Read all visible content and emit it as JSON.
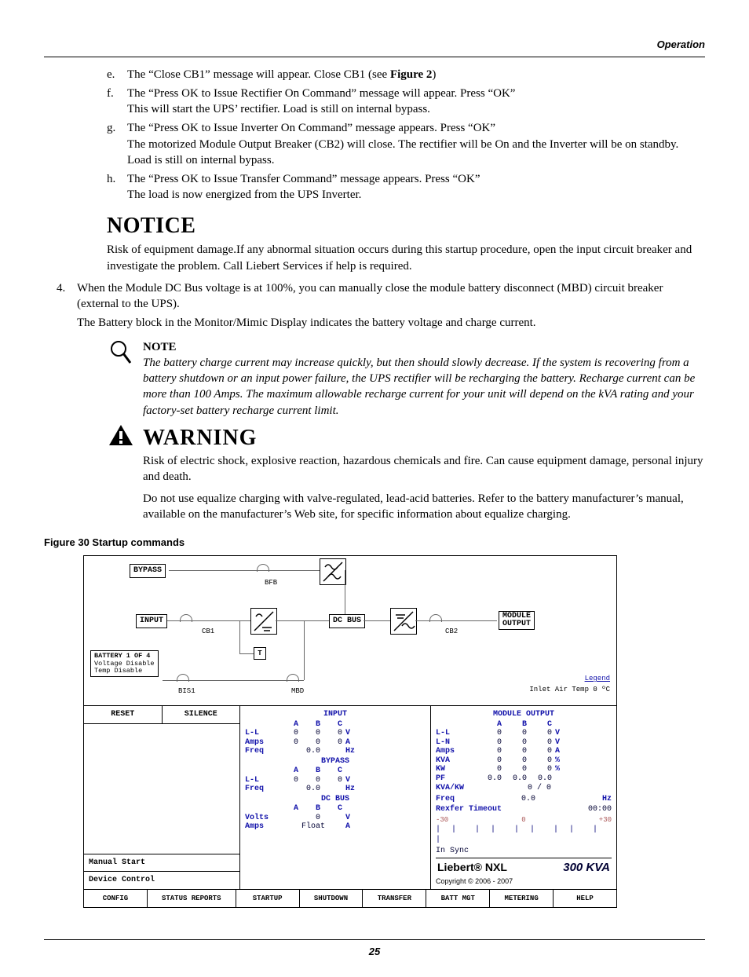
{
  "header": {
    "section": "Operation"
  },
  "steps": {
    "e": {
      "label": "e.",
      "text_a": "The “Close CB1” message will appear. Close CB1 (see ",
      "bold": "Figure 2",
      "text_b": ")"
    },
    "f": {
      "label": "f.",
      "line1": "The “Press OK to Issue Rectifier On Command” message will appear. Press “OK”",
      "line2": "This will start the UPS’ rectifier. Load is still on internal bypass."
    },
    "g": {
      "label": "g.",
      "line1": "The “Press OK to Issue Inverter On Command” message appears. Press “OK”",
      "line2": "The motorized Module Output Breaker (CB2) will close. The rectifier will be On and the Inverter will be on standby. Load is still on internal bypass."
    },
    "h": {
      "label": "h.",
      "line1": "The “Press OK to Issue Transfer Command” message appears. Press “OK”",
      "line2": "The load is now energized from the UPS Inverter."
    }
  },
  "notice": {
    "heading": "NOTICE",
    "body": "Risk of equipment damage.If any abnormal situation occurs during this startup procedure, open the input circuit breaker and investigate the problem. Call Liebert Services if help is required."
  },
  "step4": {
    "label": "4.",
    "line1": "When the Module DC Bus voltage is at 100%, you can manually close the module battery disconnect (MBD) circuit breaker (external to the UPS).",
    "line2": "The Battery block in the Monitor/Mimic Display indicates the battery voltage and charge current."
  },
  "note": {
    "heading": "NOTE",
    "body": "The battery charge current may increase quickly, but then should slowly decrease. If the system is recovering from a battery shutdown or an input power failure, the UPS rectifier will be recharging the battery. Recharge current can be more than 100 Amps. The maximum allowable recharge current for your unit will depend on the kVA rating and your factory-set battery recharge current limit."
  },
  "warning": {
    "heading": "WARNING",
    "p1": "Risk of electric shock, explosive reaction, hazardous chemicals and fire. Can cause equipment damage, personal injury and death.",
    "p2": "Do not use equalize charging with valve-regulated, lead-acid batteries. Refer to the battery manufacturer’s manual, available on the manufacturer’s Web site, for specific information about equalize charging."
  },
  "figure": {
    "caption": "Figure 30   Startup commands"
  },
  "mimic": {
    "top": {
      "bypass": "BYPASS",
      "bfb": "BFB",
      "input": "INPUT",
      "cb1": "CB1",
      "dcbus": "DC BUS",
      "cb2": "CB2",
      "module_output_l1": "MODULE",
      "module_output_l2": "OUTPUT",
      "battery_title": "BATTERY 1 OF 4",
      "batt_l1": "Voltage Disable",
      "batt_l2": "Temp   Disable",
      "bis1": "BIS1",
      "t": "T",
      "mbd": "MBD",
      "legend": "Legend",
      "inlet": "Inlet Air Temp 0 ºC"
    },
    "left": {
      "reset": "RESET",
      "silence": "SILENCE",
      "manual": "Manual Start",
      "device": "Device Control"
    },
    "center": {
      "input_hdr": "INPUT",
      "cols": {
        "a": "A",
        "b": "B",
        "c": "C"
      },
      "rows_input": [
        {
          "label": "L-L",
          "a": "0",
          "b": "0",
          "c": "0",
          "unit": "V"
        },
        {
          "label": "Amps",
          "a": "0",
          "b": "0",
          "c": "0",
          "unit": "A"
        },
        {
          "label": "Freq",
          "a": "",
          "b": "0.0",
          "c": "",
          "unit": "Hz"
        }
      ],
      "bypass_hdr": "BYPASS",
      "rows_bypass": [
        {
          "label": "L-L",
          "a": "0",
          "b": "0",
          "c": "0",
          "unit": "V"
        },
        {
          "label": "Freq",
          "a": "",
          "b": "0.0",
          "c": "",
          "unit": "Hz"
        }
      ],
      "dcbus_hdr": "DC BUS",
      "rows_dc": [
        {
          "label": "Volts",
          "a": "",
          "b": "0",
          "c": "",
          "unit": "V"
        },
        {
          "label": "Amps",
          "a": "",
          "b": "Float",
          "c": "",
          "unit": "A"
        }
      ]
    },
    "right": {
      "hdr": "MODULE OUTPUT",
      "cols": {
        "a": "A",
        "b": "B",
        "c": "C"
      },
      "rows": [
        {
          "label": "L-L",
          "a": "0",
          "b": "0",
          "c": "0",
          "unit": "V"
        },
        {
          "label": "L-N",
          "a": "0",
          "b": "0",
          "c": "0",
          "unit": "V"
        },
        {
          "label": "Amps",
          "a": "0",
          "b": "0",
          "c": "0",
          "unit": "A"
        },
        {
          "label": "KVA",
          "a": "0",
          "b": "0",
          "c": "0",
          "unit": "%"
        },
        {
          "label": "KW",
          "a": "0",
          "b": "0",
          "c": "0",
          "unit": "%"
        },
        {
          "label": "PF",
          "a": "0.0",
          "b": "0.0",
          "c": "0.0",
          "unit": ""
        }
      ],
      "kvakw_label": "KVA/KW",
      "kvakw_val": "0 /  0",
      "freq_label": "Freq",
      "freq_val": "0.0",
      "freq_unit": "Hz",
      "timeout_label": "Rexfer Timeout",
      "timeout_val": "00:00",
      "scale_lo": "-30",
      "scale_mid": "0",
      "scale_hi": "+30",
      "insync": "In Sync",
      "brand": "Liebert® NXL",
      "kva": "300 KVA",
      "copy": "Copyright © 2006 - 2007"
    },
    "bottom": {
      "config": "CONFIG",
      "status": "STATUS REPORTS",
      "startup": "STARTUP",
      "shutdown": "SHUTDOWN",
      "transfer": "TRANSFER",
      "batt": "BATT MGT",
      "metering": "METERING",
      "help": "HELP"
    }
  },
  "page_number": "25"
}
